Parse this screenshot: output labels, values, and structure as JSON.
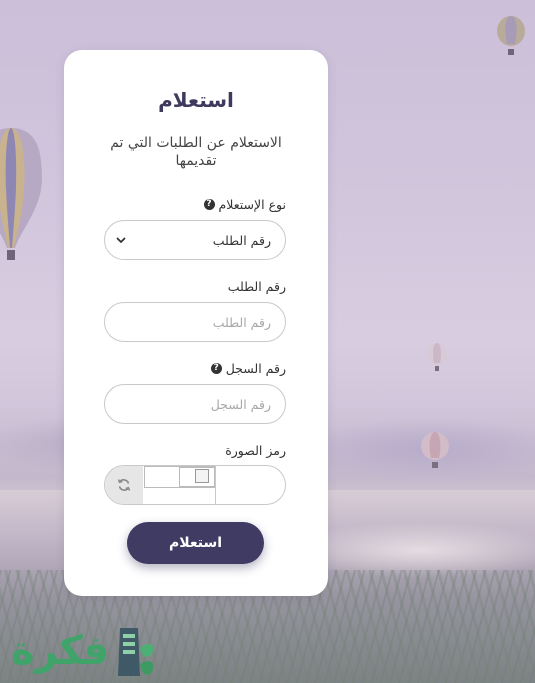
{
  "form": {
    "title": "استعلام",
    "subtitle": "الاستعلام عن الطلبات التي تم تقديمها",
    "inquiry_type_label": "نوع الإستعلام",
    "inquiry_type_value": "رقم الطلب",
    "request_number_label": "رقم الطلب",
    "request_number_placeholder": "رقم الطلب",
    "record_number_label": "رقم السجل",
    "record_number_placeholder": "رقم السجل",
    "captcha_label": "رمز الصورة",
    "submit_label": "استعلام"
  },
  "watermark": {
    "text": "فكرة"
  },
  "colors": {
    "accent": "#3f3b63",
    "logo_green": "#3fa36a"
  },
  "icons": {
    "help": "question-circle-icon",
    "chevron": "chevron-down-icon",
    "refresh": "refresh-icon",
    "broken_image": "broken-image-icon"
  }
}
